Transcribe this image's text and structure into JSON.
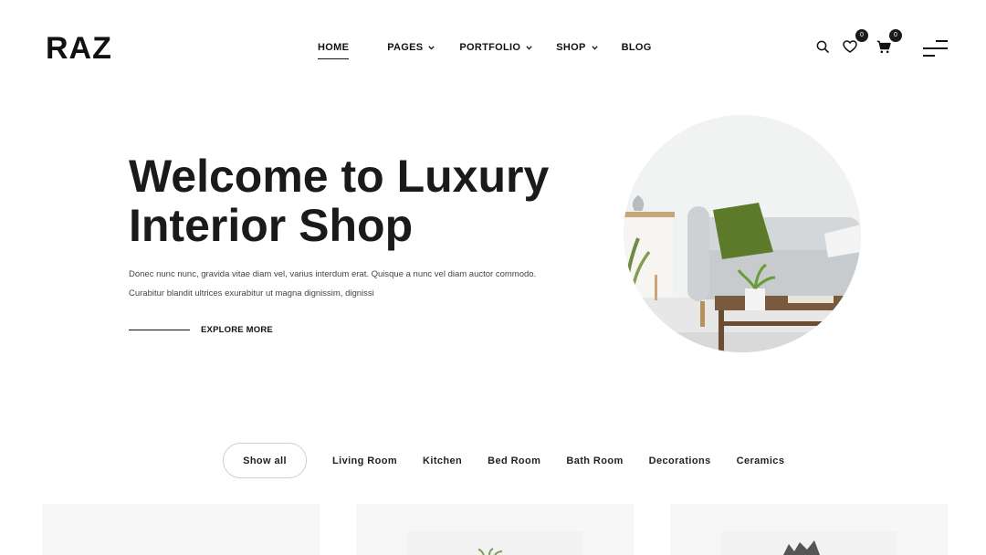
{
  "header": {
    "logo": "RAZ",
    "nav": [
      {
        "label": "HOME",
        "active": true,
        "dropdown": false
      },
      {
        "label": "PAGES",
        "active": false,
        "dropdown": true
      },
      {
        "label": "PORTFOLIO",
        "active": false,
        "dropdown": true
      },
      {
        "label": "SHOP",
        "active": false,
        "dropdown": true
      },
      {
        "label": "BLOG",
        "active": false,
        "dropdown": false
      }
    ],
    "icons": {
      "search": "search-icon",
      "wishlist": "heart-icon",
      "wishlist_badge": "0",
      "cart": "cart-icon",
      "cart_badge": "0",
      "menu": "hamburger-menu-icon"
    }
  },
  "hero": {
    "title_line1": "Welcome to Luxury",
    "title_line2": "Interior Shop",
    "text_line1": "Donec nunc nunc, gravida vitae diam vel, varius interdum erat. Quisque a nunc vel diam auctor commodo.",
    "text_line2": "Curabitur blandit ultrices exurabitur ut magna dignissim, dignissi",
    "cta": "EXPLORE MORE"
  },
  "filters": {
    "items": [
      "Show all",
      "Living Room",
      "Kitchen",
      "Bed Room",
      "Bath Room",
      "Decorations",
      "Ceramics"
    ],
    "active_index": 0
  },
  "colors": {
    "text": "#1a1a1a",
    "background": "#ffffff",
    "card_bg": "#f7f7f7",
    "sofa": "#c9cdd1",
    "pillow": "#5d7a2a"
  }
}
